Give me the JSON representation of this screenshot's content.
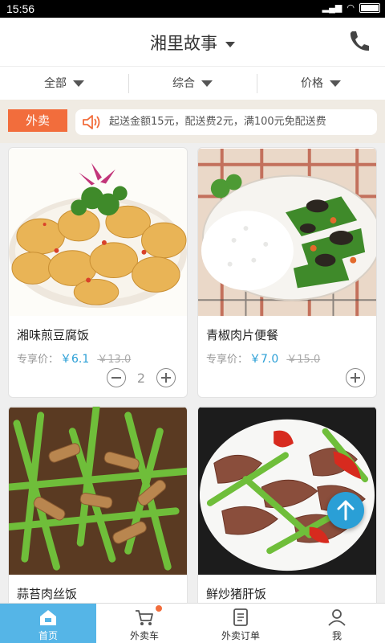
{
  "status": {
    "time": "15:56"
  },
  "header": {
    "title": "湘里故事"
  },
  "filters": [
    {
      "label": "全部"
    },
    {
      "label": "综合"
    },
    {
      "label": "价格"
    }
  ],
  "notice": {
    "tag": "外卖",
    "text": "起送金额15元，配送费2元，满100元免配送费"
  },
  "products": [
    {
      "name": "湘味煎豆腐饭",
      "price_label": "专享价：",
      "price": "￥6.1",
      "old_price": "￥13.0",
      "qty": "2"
    },
    {
      "name": "青椒肉片便餐",
      "price_label": "专享价：",
      "price": "￥7.0",
      "old_price": "￥15.0"
    },
    {
      "name": "蒜苔肉丝饭"
    },
    {
      "name": "鲜炒猪肝饭"
    }
  ],
  "tabs": [
    {
      "label": "首页"
    },
    {
      "label": "外卖车"
    },
    {
      "label": "外卖订单"
    },
    {
      "label": "我"
    }
  ],
  "colors": {
    "accent": "#55b5e7",
    "price": "#2a9fd6",
    "tag": "#f26d3c"
  }
}
